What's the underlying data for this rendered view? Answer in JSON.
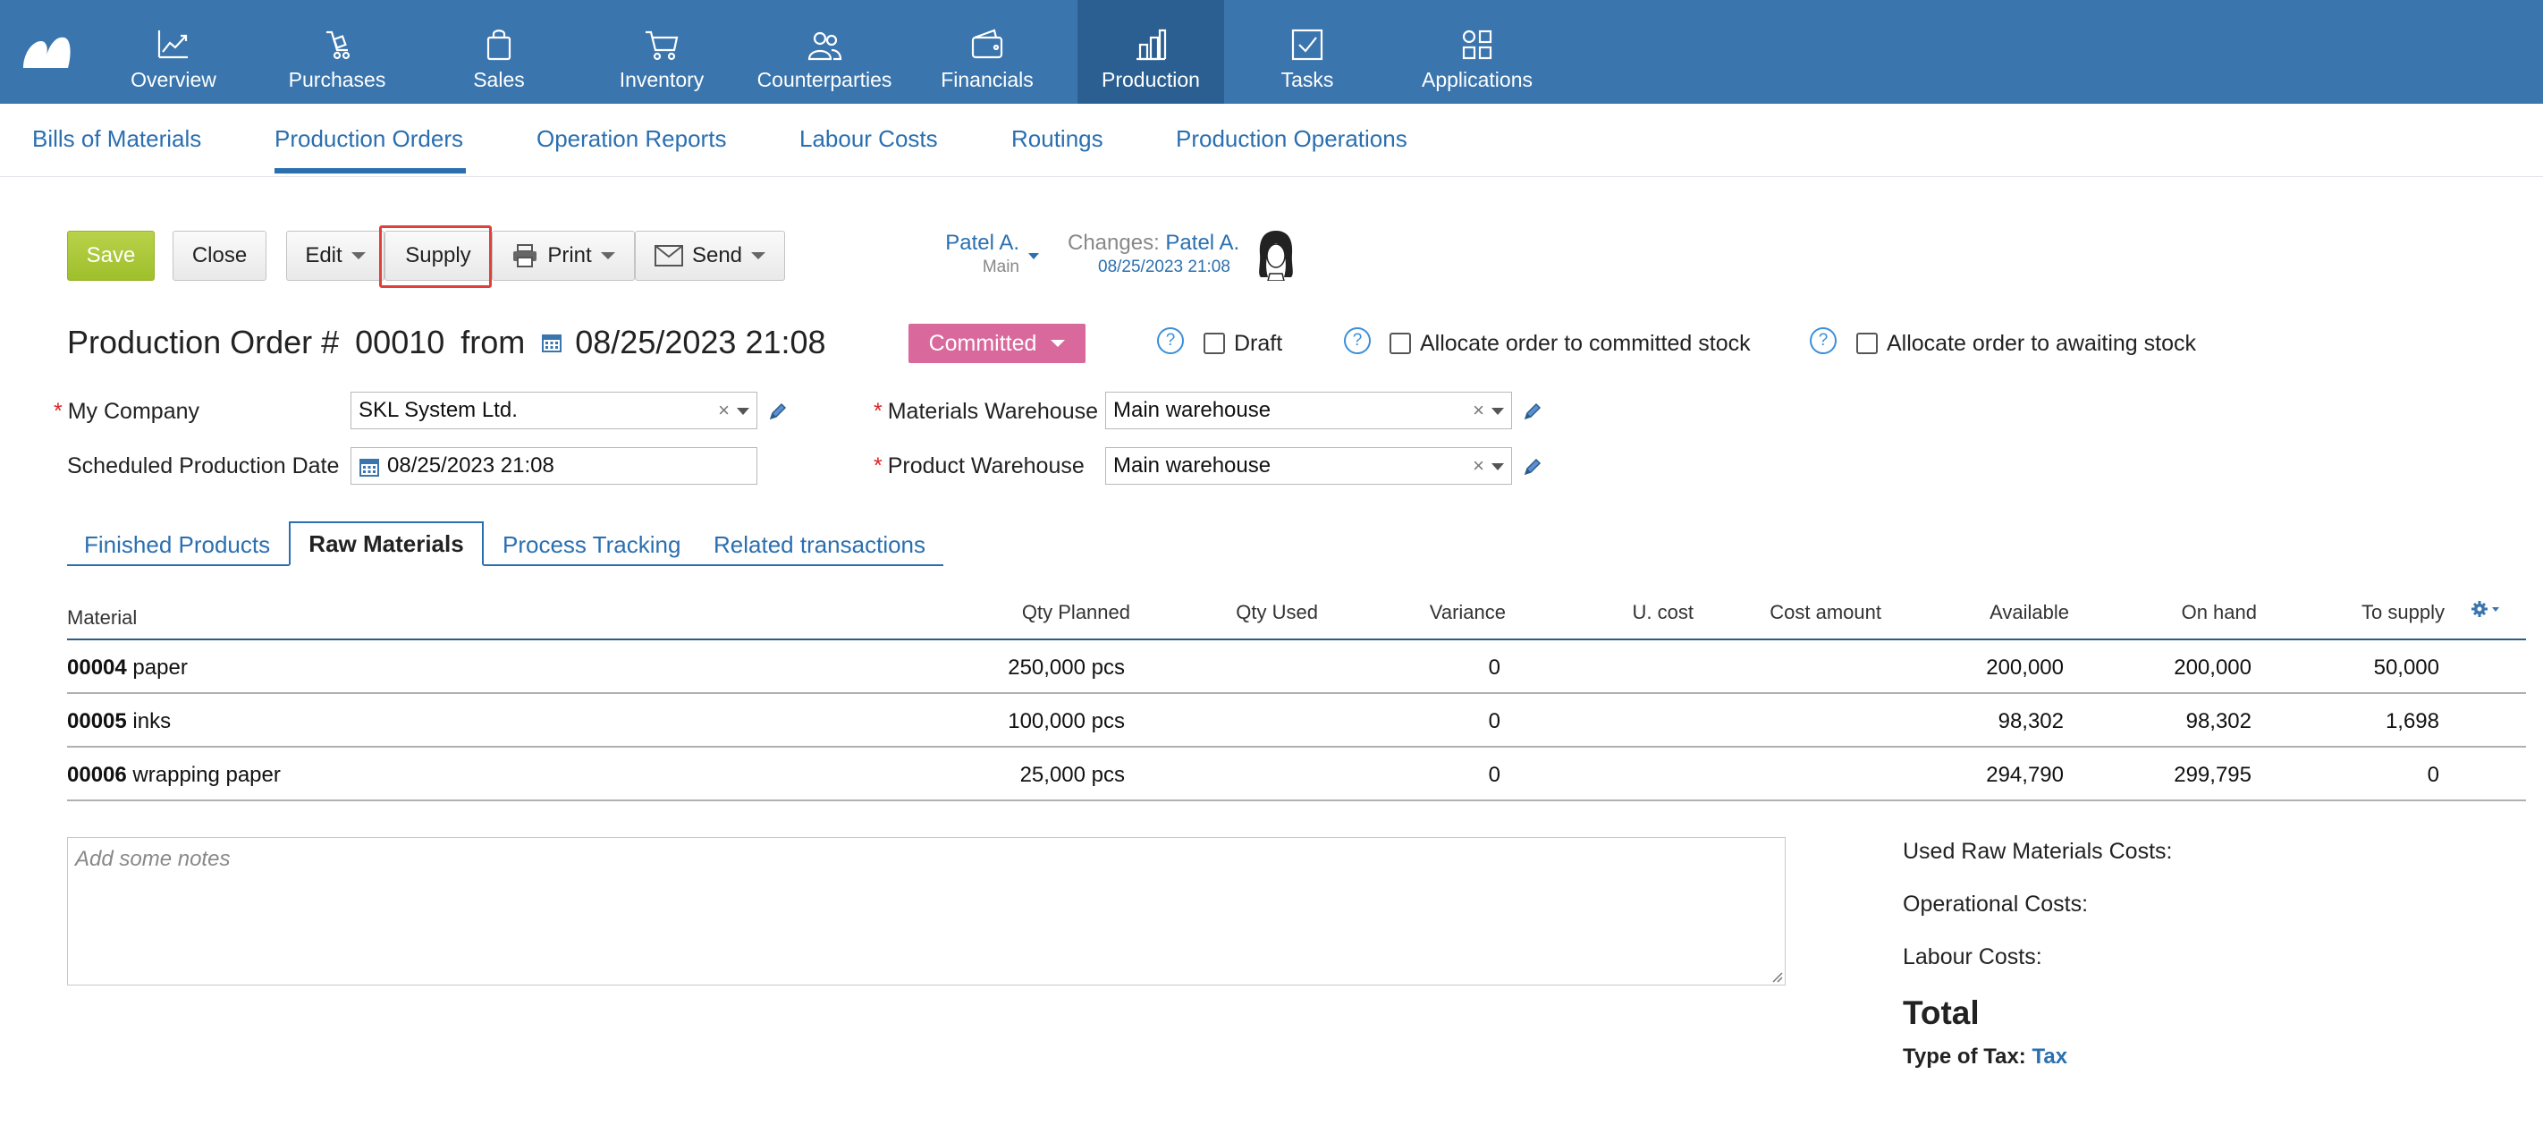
{
  "nav": {
    "items": [
      {
        "label": "Overview",
        "icon": "chart-line-icon"
      },
      {
        "label": "Purchases",
        "icon": "purchases-icon"
      },
      {
        "label": "Sales",
        "icon": "shopping-bag-icon"
      },
      {
        "label": "Inventory",
        "icon": "cart-icon"
      },
      {
        "label": "Counterparties",
        "icon": "people-icon"
      },
      {
        "label": "Financials",
        "icon": "wallet-icon"
      },
      {
        "label": "Production",
        "icon": "factory-icon"
      },
      {
        "label": "Tasks",
        "icon": "checkbox-icon"
      },
      {
        "label": "Applications",
        "icon": "apps-grid-icon"
      }
    ],
    "active": "Production"
  },
  "subnav": {
    "items": [
      "Bills of Materials",
      "Production Orders",
      "Operation Reports",
      "Labour Costs",
      "Routings",
      "Production Operations"
    ],
    "active": "Production Orders"
  },
  "toolbar": {
    "save": "Save",
    "close": "Close",
    "edit": "Edit",
    "supply": "Supply",
    "print": "Print",
    "send": "Send"
  },
  "owner": {
    "name": "Patel A.",
    "group": "Main",
    "changes_label": "Changes:",
    "changes_by": "Patel A.",
    "changes_date": "08/25/2023 21:08"
  },
  "order": {
    "title": "Production Order #",
    "number": "00010",
    "from": "from",
    "date": "08/25/2023 21:08",
    "status": "Committed",
    "draft_label": "Draft",
    "allocate_committed": "Allocate order to committed stock",
    "allocate_awaiting": "Allocate order to awaiting stock"
  },
  "form": {
    "company_label": "My Company",
    "company_value": "SKL System Ltd.",
    "sched_label": "Scheduled Production Date",
    "sched_value": "08/25/2023 21:08",
    "mat_wh_label": "Materials Warehouse",
    "mat_wh_value": "Main warehouse",
    "prod_wh_label": "Product Warehouse",
    "prod_wh_value": "Main warehouse"
  },
  "tabs": [
    "Finished Products",
    "Raw Materials",
    "Process Tracking",
    "Related transactions"
  ],
  "active_tab": "Raw Materials",
  "table": {
    "headers": [
      "Material",
      "Qty Planned",
      "Qty Used",
      "Variance",
      "U. cost",
      "Cost amount",
      "Available",
      "On hand",
      "To supply"
    ],
    "rows": [
      {
        "code": "00004",
        "name": "paper",
        "qty_planned": "250,000 pcs",
        "variance": "0",
        "available": "200,000",
        "on_hand": "200,000",
        "to_supply": "50,000"
      },
      {
        "code": "00005",
        "name": "inks",
        "qty_planned": "100,000 pcs",
        "variance": "0",
        "available": "98,302",
        "on_hand": "98,302",
        "to_supply": "1,698"
      },
      {
        "code": "00006",
        "name": "wrapping paper",
        "qty_planned": "25,000 pcs",
        "variance": "0",
        "available": "294,790",
        "on_hand": "299,795",
        "to_supply": "0"
      }
    ]
  },
  "notes": {
    "placeholder": "Add some notes"
  },
  "summary": {
    "raw_costs": "Used Raw Materials Costs:",
    "op_costs": "Operational Costs:",
    "labour_costs": "Labour Costs:",
    "total": "Total",
    "tax_label": "Type of Tax:",
    "tax_value": "Tax"
  },
  "colors": {
    "nav_bg": "#3a75ad",
    "nav_active": "#2c5f91",
    "accent": "#2a6fb0",
    "save_btn": "#a6c431",
    "status": "#d9689c",
    "highlight": "#e0403a"
  }
}
